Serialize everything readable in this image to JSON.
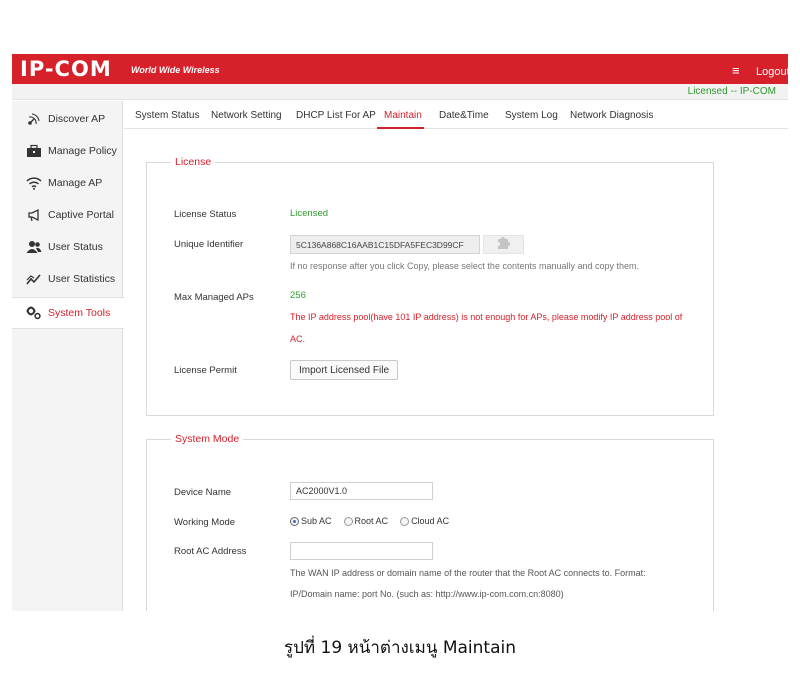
{
  "header": {
    "logo": "IP-COM",
    "slogan": "World Wide Wireless",
    "menu_icon": "≡",
    "logout": "Logout",
    "license_status": "Licensed -- IP-COM"
  },
  "sidebar": {
    "items": [
      {
        "label": "Discover AP",
        "icon": "radar-icon"
      },
      {
        "label": "Manage Policy",
        "icon": "briefcase-icon"
      },
      {
        "label": "Manage AP",
        "icon": "wifi-icon"
      },
      {
        "label": "Captive Portal",
        "icon": "megaphone-icon"
      },
      {
        "label": "User Status",
        "icon": "users-icon"
      },
      {
        "label": "User Statistics",
        "icon": "chart-icon"
      },
      {
        "label": "System Tools",
        "icon": "gears-icon",
        "active": true
      }
    ]
  },
  "tabs": {
    "items": [
      "System Status",
      "Network Setting",
      "DHCP List For AP",
      "Maintain",
      "Date&Time",
      "System Log",
      "Network Diagnosis"
    ],
    "active": "Maintain"
  },
  "license": {
    "legend": "License",
    "status_label": "License Status",
    "status_value": "Licensed",
    "uid_label": "Unique Identifier",
    "uid_value": "5C136A868C16AAB1C15DFA5FEC3D99CF",
    "uid_hint": "If no response after you click Copy, please select the contents manually and copy them.",
    "max_label": "Max Managed APs",
    "max_value": "256",
    "warning_line1": "The IP address pool(have 101 IP address) is not enough for APs, please modify IP address pool of",
    "warning_line2": "AC.",
    "permit_label": "License Permit",
    "import_button": "Import Licensed File"
  },
  "system_mode": {
    "legend": "System Mode",
    "device_name_label": "Device Name",
    "device_name_value": "AC2000V1.0",
    "working_mode_label": "Working Mode",
    "modes": [
      "Sub AC",
      "Root AC",
      "Cloud AC"
    ],
    "selected_mode": "Sub AC",
    "root_ac_label": "Root AC Address",
    "root_ac_value": "",
    "root_hint_line1": "The WAN IP address or domain name of the router that the Root AC connects to. Format:",
    "root_hint_line2": "IP/Domain name: port No. (such as: http://www.ip-com.com.cn:8080)"
  },
  "caption": "รูปที่ 19 หน้าต่างเมนู Maintain",
  "colors": {
    "brand": "#d6202a",
    "licensed": "#2e9b2e"
  }
}
